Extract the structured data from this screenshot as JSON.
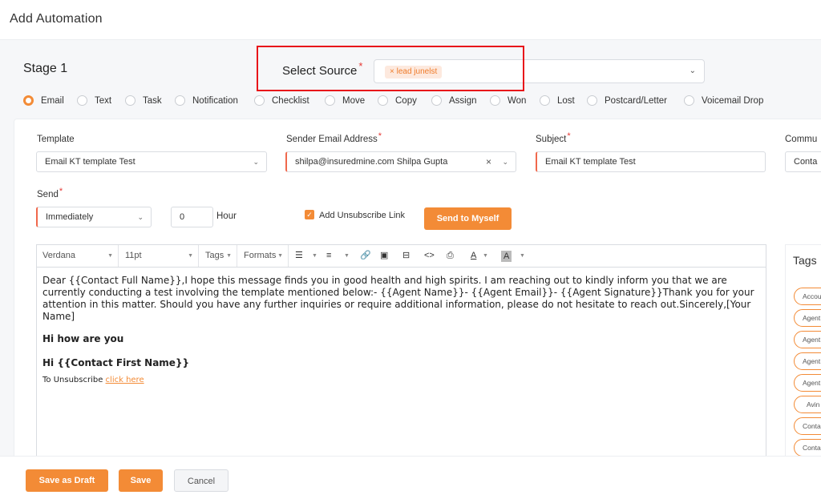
{
  "header": {
    "title": "Add Automation"
  },
  "stage": {
    "label": "Stage 1"
  },
  "source": {
    "label": "Select Source",
    "required": "*",
    "chip": "lead junelst",
    "chip_remove": "×"
  },
  "types": [
    {
      "label": "Email",
      "selected": true
    },
    {
      "label": "Text",
      "selected": false
    },
    {
      "label": "Task",
      "selected": false
    },
    {
      "label": "Notification",
      "selected": false
    },
    {
      "label": "Checklist",
      "selected": false
    },
    {
      "label": "Move",
      "selected": false
    },
    {
      "label": "Copy",
      "selected": false
    },
    {
      "label": "Assign",
      "selected": false
    },
    {
      "label": "Won",
      "selected": false
    },
    {
      "label": "Lost",
      "selected": false
    },
    {
      "label": "Postcard/Letter",
      "selected": false
    },
    {
      "label": "Voicemail Drop",
      "selected": false
    }
  ],
  "form": {
    "template_label": "Template",
    "template_value": "Email KT template Test",
    "sender_label": "Sender Email Address",
    "sender_value": "shilpa@insuredmine.com Shilpa Gupta",
    "subject_label": "Subject",
    "subject_value": "Email KT template Test",
    "comm_label": "Commu",
    "comm_value": "Conta",
    "send_label": "Send",
    "send_value": "Immediately",
    "hour_value": "0",
    "hour_label": "Hour",
    "unsubscribe_label": "Add Unsubscribe Link",
    "unsubscribe_checked": true,
    "send_myself": "Send to Myself",
    "required_mark": "*"
  },
  "editor": {
    "font": "Verdana",
    "size": "11pt",
    "tags": "Tags",
    "formats": "Formats",
    "body_paragraph": "Dear {{Contact Full Name}},I hope this message finds you in good health and high spirits. I am reaching out to kindly inform you that we are currently conducting a test involving the template mentioned below:- {{Agent Name}}- {{Agent Email}}- {{Agent Signature}}Thank you for your attention in this matter. Should you have any further inquiries or require additional information, please do not hesitate to reach out.Sincerely,[Your Name]",
    "line2": "Hi how are you",
    "line3": "Hi {{Contact First Name}}",
    "unsub_text": "To Unsubscribe ",
    "unsub_link": "click here"
  },
  "tags_panel": {
    "title": "Tags",
    "items": [
      "Accou",
      "Agent",
      "Agent",
      "Agent",
      "Agent",
      "Avin",
      "Conta",
      "Conta"
    ]
  },
  "footer": {
    "draft": "Save as Draft",
    "save": "Save",
    "cancel": "Cancel"
  },
  "colors": {
    "accent": "#f38b36",
    "highlight": "#e8141a",
    "required": "#e53935"
  }
}
